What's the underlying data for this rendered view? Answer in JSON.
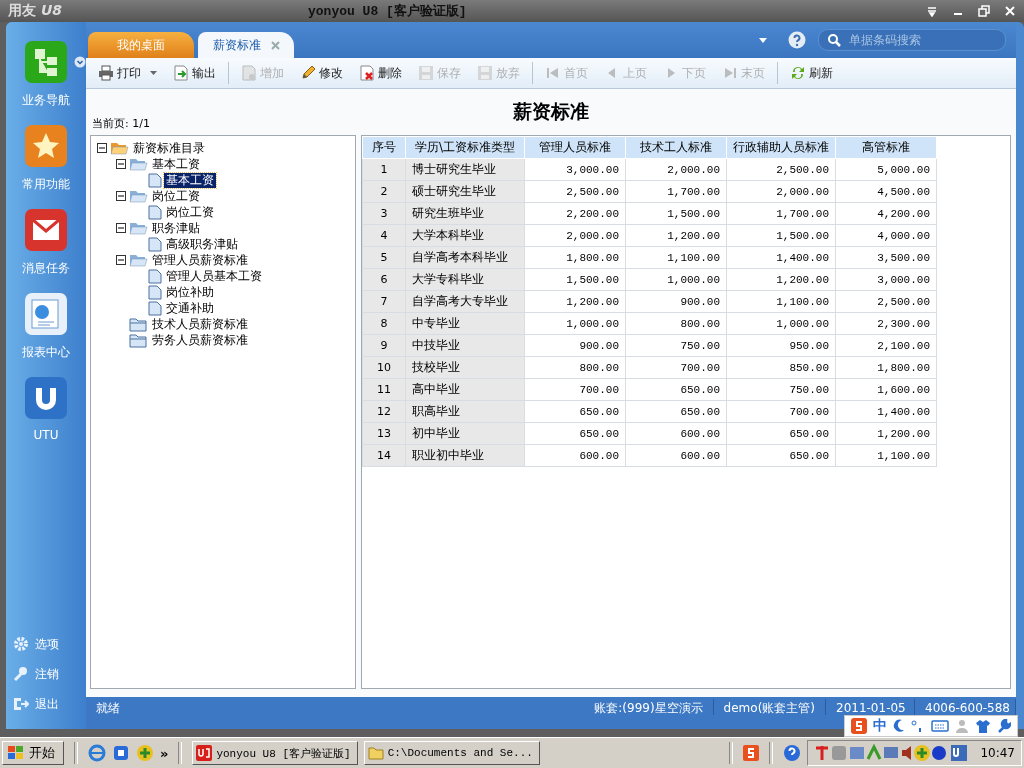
{
  "title_bar": {
    "logo": "用友",
    "logo_suffix": "U8",
    "title": "yonyou U8 [客户验证版]"
  },
  "nav": [
    {
      "label": "业务导航",
      "kind": "business"
    },
    {
      "label": "常用功能",
      "kind": "favorite"
    },
    {
      "label": "消息任务",
      "kind": "message"
    },
    {
      "label": "报表中心",
      "kind": "report"
    },
    {
      "label": "UTU",
      "kind": "utu"
    }
  ],
  "nav_bottom": [
    {
      "label": "选项",
      "kind": "options"
    },
    {
      "label": "注销",
      "kind": "logout"
    },
    {
      "label": "退出",
      "kind": "exit"
    }
  ],
  "tabs": [
    {
      "label": "我的桌面",
      "selected": false,
      "closable": false
    },
    {
      "label": "薪资标准",
      "selected": true,
      "closable": true
    }
  ],
  "search": {
    "placeholder": "单据条码搜索"
  },
  "toolbar": [
    {
      "label": "打印",
      "kind": "print",
      "disabled": false,
      "dropdown": true
    },
    {
      "label": "输出",
      "kind": "export",
      "disabled": false,
      "dropdown": false
    },
    {
      "kind": "separator"
    },
    {
      "label": "增加",
      "kind": "add",
      "disabled": true,
      "dropdown": false
    },
    {
      "label": "修改",
      "kind": "edit",
      "disabled": false,
      "dropdown": false
    },
    {
      "label": "删除",
      "kind": "delete",
      "disabled": false,
      "dropdown": false
    },
    {
      "label": "保存",
      "kind": "save",
      "disabled": true,
      "dropdown": false
    },
    {
      "label": "放弃",
      "kind": "discard",
      "disabled": true,
      "dropdown": false
    },
    {
      "kind": "separator"
    },
    {
      "label": "首页",
      "kind": "first",
      "disabled": true,
      "dropdown": false
    },
    {
      "label": "上页",
      "kind": "prev",
      "disabled": true,
      "dropdown": false
    },
    {
      "label": "下页",
      "kind": "next",
      "disabled": true,
      "dropdown": false
    },
    {
      "label": "末页",
      "kind": "last",
      "disabled": true,
      "dropdown": false
    },
    {
      "kind": "separator"
    },
    {
      "label": "刷新",
      "kind": "refresh",
      "disabled": false,
      "dropdown": false
    }
  ],
  "page_info": "当前页: 1/1",
  "heading": "薪资标准",
  "tree": {
    "items": [
      {
        "label": "薪资标准目录",
        "kind": "folder",
        "expanded": true,
        "selected": false,
        "children": [
          {
            "label": "基本工资",
            "kind": "folder",
            "expanded": true,
            "selected": false,
            "children": [
              {
                "label": "基本工资",
                "kind": "document",
                "selected": true
              }
            ]
          },
          {
            "label": "岗位工资",
            "kind": "folder",
            "expanded": true,
            "selected": false,
            "children": [
              {
                "label": "岗位工资",
                "kind": "document",
                "selected": false
              }
            ]
          },
          {
            "label": "职务津贴",
            "kind": "folder",
            "expanded": true,
            "selected": false,
            "children": [
              {
                "label": "高级职务津贴",
                "kind": "document",
                "selected": false
              }
            ]
          },
          {
            "label": "管理人员薪资标准",
            "kind": "folder",
            "expanded": true,
            "selected": false,
            "children": [
              {
                "label": "管理人员基本工资",
                "kind": "document",
                "selected": false
              },
              {
                "label": "岗位补助",
                "kind": "document",
                "selected": false
              },
              {
                "label": "交通补助",
                "kind": "document",
                "selected": false
              }
            ]
          },
          {
            "label": "技术人员薪资标准",
            "kind": "folder",
            "expanded": false,
            "selected": false
          },
          {
            "label": "劳务人员薪资标准",
            "kind": "folder",
            "expanded": false,
            "selected": false
          }
        ]
      }
    ]
  },
  "table": {
    "columns": [
      "序号",
      "学历\\工资标准类型",
      "管理人员标准",
      "技术工人标准",
      "行政辅助人员标准",
      "高管标准"
    ],
    "rows": [
      [
        "1",
        "博士研究生毕业",
        "3,000.00",
        "2,000.00",
        "2,500.00",
        "5,000.00"
      ],
      [
        "2",
        "硕士研究生毕业",
        "2,500.00",
        "1,700.00",
        "2,000.00",
        "4,500.00"
      ],
      [
        "3",
        "研究生班毕业",
        "2,200.00",
        "1,500.00",
        "1,700.00",
        "4,200.00"
      ],
      [
        "4",
        "大学本科毕业",
        "2,000.00",
        "1,200.00",
        "1,500.00",
        "4,000.00"
      ],
      [
        "5",
        "自学高考本科毕业",
        "1,800.00",
        "1,100.00",
        "1,400.00",
        "3,500.00"
      ],
      [
        "6",
        "大学专科毕业",
        "1,500.00",
        "1,000.00",
        "1,200.00",
        "3,000.00"
      ],
      [
        "7",
        "自学高考大专毕业",
        "1,200.00",
        "900.00",
        "1,100.00",
        "2,500.00"
      ],
      [
        "8",
        "中专毕业",
        "1,000.00",
        "800.00",
        "1,000.00",
        "2,300.00"
      ],
      [
        "9",
        "中技毕业",
        "900.00",
        "750.00",
        "950.00",
        "2,100.00"
      ],
      [
        "10",
        "技校毕业",
        "800.00",
        "700.00",
        "850.00",
        "1,800.00"
      ],
      [
        "11",
        "高中毕业",
        "700.00",
        "650.00",
        "750.00",
        "1,600.00"
      ],
      [
        "12",
        "职高毕业",
        "650.00",
        "650.00",
        "700.00",
        "1,400.00"
      ],
      [
        "13",
        "初中毕业",
        "650.00",
        "600.00",
        "650.00",
        "1,200.00"
      ],
      [
        "14",
        "职业初中毕业",
        "600.00",
        "600.00",
        "650.00",
        "1,100.00"
      ]
    ]
  },
  "status_bar": [
    "就绪",
    "账套:(999)星空演示",
    "demo(账套主管)",
    "2011-01-05",
    "4006-600-588"
  ],
  "ime_bar": {
    "label": "中"
  },
  "taskbar": {
    "start": "开始",
    "more": "»",
    "tasks": [
      {
        "label": "yonyou U8 [客户验证版]",
        "kind": "app"
      },
      {
        "label": "C:\\Documents and Se...",
        "kind": "folder"
      }
    ],
    "clock": "10:47"
  }
}
